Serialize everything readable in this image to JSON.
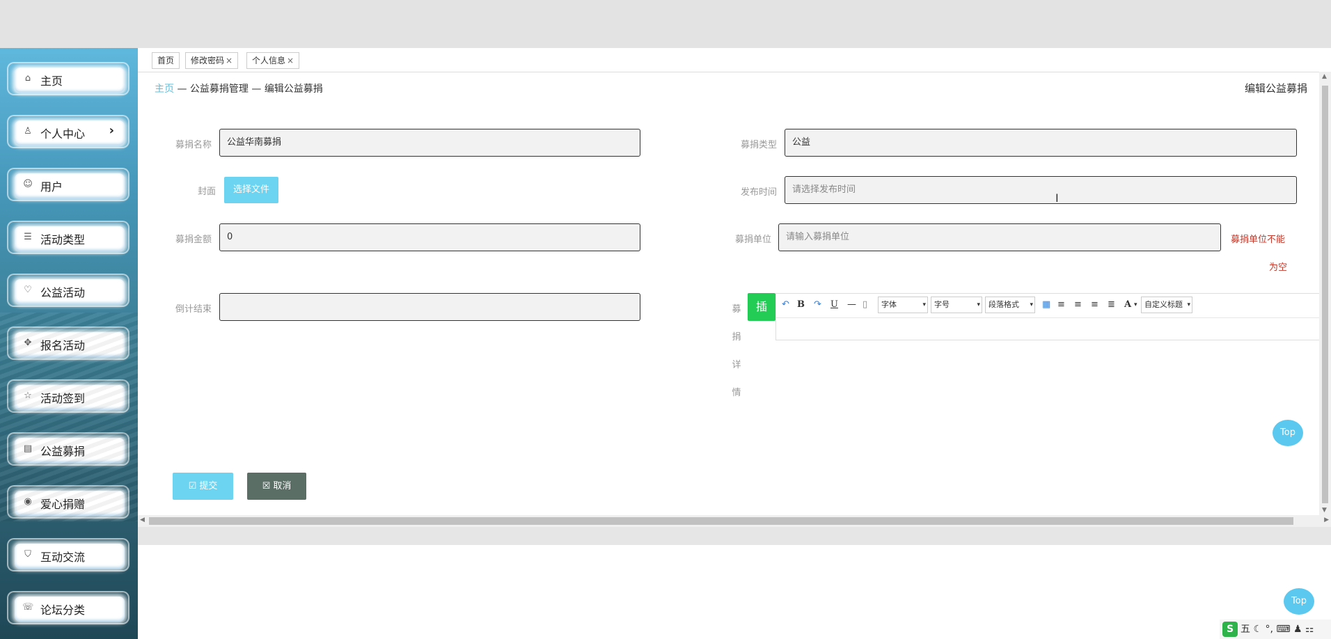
{
  "sidebar": {
    "items": [
      {
        "label": "主页",
        "icon": "home-icon",
        "glyph": "⌂"
      },
      {
        "label": "个人中心",
        "icon": "user-icon",
        "glyph": "♙",
        "arrow": "›"
      },
      {
        "label": "用户",
        "icon": "circle-user-icon",
        "glyph": "☺"
      },
      {
        "label": "活动类型",
        "icon": "list-icon",
        "glyph": "☰"
      },
      {
        "label": "公益活动",
        "icon": "heart-icon",
        "glyph": "♡"
      },
      {
        "label": "报名活动",
        "icon": "expand-icon",
        "glyph": "✥"
      },
      {
        "label": "活动签到",
        "icon": "star-icon",
        "glyph": "☆"
      },
      {
        "label": "公益募捐",
        "icon": "chart-icon",
        "glyph": "▤"
      },
      {
        "label": "爱心捐赠",
        "icon": "target-icon",
        "glyph": "◉"
      },
      {
        "label": "互动交流",
        "icon": "shield-icon",
        "glyph": "⛉"
      },
      {
        "label": "论坛分类",
        "icon": "chat-icon",
        "glyph": "☏"
      }
    ]
  },
  "tabs": [
    {
      "label": "首页",
      "closable": false
    },
    {
      "label": "修改密码",
      "closable": true
    },
    {
      "label": "个人信息",
      "closable": true
    }
  ],
  "tab_close_glyph": "×",
  "breadcrumb": {
    "home": "主页",
    "sep": " — ",
    "level1": "公益募捐管理",
    "level2": "编辑公益募捐"
  },
  "page_title": "编辑公益募捐",
  "form": {
    "name_label": "募捐名称",
    "name_value": "公益华南募捐",
    "type_label": "募捐类型",
    "type_value": "公益",
    "cover_label": "封面",
    "cover_button": "选择文件",
    "publish_label": "发布时间",
    "publish_placeholder": "请选择发布时间",
    "amount_label": "募捐金额",
    "amount_value": "0",
    "unit_label": "募捐单位",
    "unit_placeholder": "请输入募捐单位",
    "unit_error_1": "募捐单位不能",
    "unit_error_2": "为空",
    "countdown_label": "倒计结束",
    "countdown_value": "",
    "detail_label_chars": [
      "募",
      "捐",
      "详",
      "情"
    ],
    "insert_button": "插"
  },
  "editor": {
    "bold": "B",
    "underline": "U",
    "font_color": "A",
    "font_family": "字体",
    "font_size": "字号",
    "paragraph": "段落格式",
    "custom_title": "自定义标题"
  },
  "buttons": {
    "submit": "提交",
    "cancel": "取消"
  },
  "top_button": "Top",
  "ime": {
    "logo": "S",
    "mode": "五",
    "extras": "☾ °, ⌨ ♟ ⚏"
  },
  "colors": {
    "accent": "#5bc0de",
    "submit": "#6cd3f0",
    "cancel": "#5a6e66",
    "insert": "#22cc55",
    "error": "#c0392b"
  }
}
